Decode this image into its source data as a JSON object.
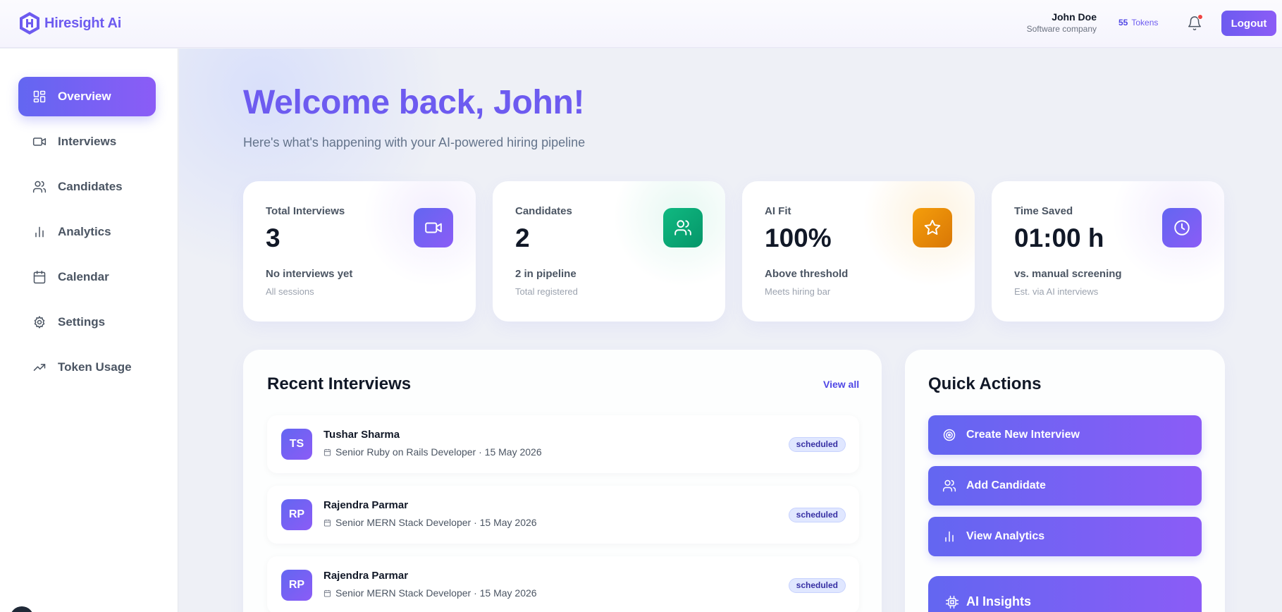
{
  "header": {
    "brand": "Hiresight Ai",
    "user_name": "John Doe",
    "user_company": "Software company",
    "tokens_count": "55",
    "tokens_label": "Tokens",
    "logout_label": "Logout"
  },
  "sidebar": {
    "items": [
      {
        "label": "Overview",
        "icon": "grid-icon",
        "active": true
      },
      {
        "label": "Interviews",
        "icon": "video-icon"
      },
      {
        "label": "Candidates",
        "icon": "users-icon"
      },
      {
        "label": "Analytics",
        "icon": "bar-chart-icon"
      },
      {
        "label": "Calendar",
        "icon": "calendar-icon"
      },
      {
        "label": "Settings",
        "icon": "gear-icon"
      },
      {
        "label": "Token Usage",
        "icon": "trending-up-icon"
      }
    ]
  },
  "main": {
    "welcome": "Welcome back, John!",
    "subtitle": "Here's what's happening with your AI-powered hiring pipeline"
  },
  "stats": [
    {
      "label": "Total Interviews",
      "value": "3",
      "note": "No interviews yet",
      "sub": "All sessions",
      "icon": "video-icon",
      "color": "#7c5cf0"
    },
    {
      "label": "Candidates",
      "value": "2",
      "note": "2 in pipeline",
      "sub": "Total registered",
      "icon": "users-icon",
      "color": "#10a46e"
    },
    {
      "label": "AI Fit",
      "value": "100%",
      "note": "Above threshold",
      "sub": "Meets hiring bar",
      "icon": "star-icon",
      "color": "#f08c08"
    },
    {
      "label": "Time Saved",
      "value": "01:00 h",
      "note": "vs. manual screening",
      "sub": "Est. via AI interviews",
      "icon": "clock-icon",
      "color": "#7c5cf0"
    }
  ],
  "recent": {
    "title": "Recent Interviews",
    "view_all": "View all",
    "rows": [
      {
        "initials": "TS",
        "name": "Tushar Sharma",
        "meta": "Senior Ruby on Rails Developer · 15 May 2026",
        "status": "scheduled"
      },
      {
        "initials": "RP",
        "name": "Rajendra Parmar",
        "meta": "Senior MERN Stack Developer · 15 May 2026",
        "status": "scheduled"
      },
      {
        "initials": "RP",
        "name": "Rajendra Parmar",
        "meta": "Senior MERN Stack Developer · 15 May 2026",
        "status": "scheduled"
      }
    ]
  },
  "quick_actions": {
    "title": "Quick Actions",
    "buttons": [
      {
        "label": "Create New Interview",
        "icon": "target-icon"
      },
      {
        "label": "Add Candidate",
        "icon": "users-icon"
      },
      {
        "label": "View Analytics",
        "icon": "bar-chart-icon"
      }
    ],
    "insights_label": "AI Insights"
  },
  "colors": {
    "accent": "#6d5bf0",
    "accent_gradient_end": "#8b5cf6",
    "success": "#10a46e",
    "warning": "#f08c08"
  }
}
